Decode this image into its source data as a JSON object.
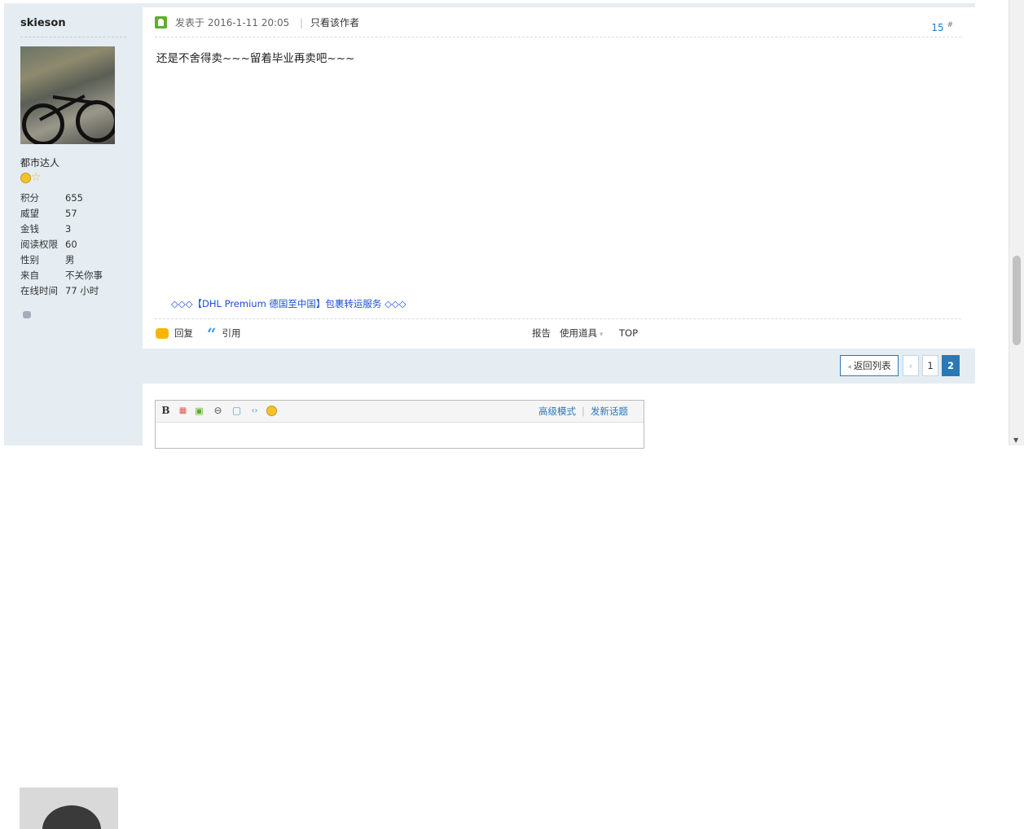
{
  "author": {
    "username": "skieson",
    "group": "都市达人",
    "stats": [
      {
        "label": "积分",
        "value": "655"
      },
      {
        "label": "威望",
        "value": "57"
      },
      {
        "label": "金钱",
        "value": "3"
      },
      {
        "label": "阅读权限",
        "value": "60"
      },
      {
        "label": "性别",
        "value": "男"
      },
      {
        "label": "来自",
        "value": "不关你事"
      },
      {
        "label": "在线时间",
        "value": "77 小时"
      }
    ]
  },
  "post": {
    "date": "发表于 2016-1-11 20:05",
    "separator": "|",
    "only_author": "只看该作者",
    "floor": "15",
    "floor_mark": "#",
    "content": "还是不舍得卖~~~留着毕业再卖吧~~~",
    "promo": "◇◇◇【DHL Premium 德国至中国】包裹转运服务 ◇◇◇"
  },
  "actions": {
    "reply": "回复",
    "quote": "引用",
    "report": "报告",
    "tools": "使用道具",
    "top": "TOP"
  },
  "pager": {
    "back": "返回列表",
    "prev": "‹",
    "page1": "1",
    "page2": "2"
  },
  "editor": {
    "advanced": "高级模式",
    "separator": "|",
    "new_topic": "发新话题"
  },
  "colors": {
    "accent": "#2b78b6",
    "panel": "#e5edf2",
    "promo_link": "#1a4fd6"
  }
}
